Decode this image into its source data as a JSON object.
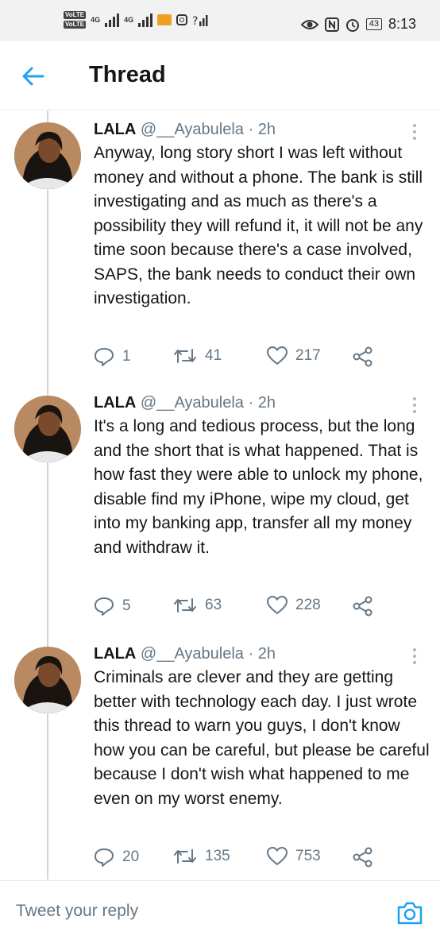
{
  "status_bar": {
    "network_badges": [
      "VoLTE",
      "VoLTE"
    ],
    "network_types": [
      "4G",
      "4G"
    ],
    "battery": "43",
    "time": "8:13",
    "icons": [
      "signal-icon",
      "instagram-icon",
      "wifi-icon",
      "eye-icon",
      "nfc-icon",
      "alarm-icon"
    ]
  },
  "header": {
    "title": "Thread"
  },
  "tweets": [
    {
      "author": "LALA",
      "handle": "@__Ayabulela",
      "time": "· 2h",
      "text": "Anyway, long story short I was left without money and without a phone. The bank is still investigating and as much as there's a possibility they will refund it, it will not be any time soon because there's a case involved, SAPS, the bank needs to conduct their own investigation.",
      "replies": "1",
      "retweets": "41",
      "likes": "217"
    },
    {
      "author": "LALA",
      "handle": "@__Ayabulela",
      "time": "· 2h",
      "text": "It's a long and tedious process, but the long and the short that is what happened. That is how fast they were able to unlock my phone, disable find my iPhone, wipe my cloud, get into my banking app, transfer all my money and withdraw it.",
      "replies": "5",
      "retweets": "63",
      "likes": "228"
    },
    {
      "author": "LALA",
      "handle": "@__Ayabulela",
      "time": "· 2h",
      "text": "Criminals are clever and they are getting better with technology each day. I just wrote this thread to warn you guys, I don't know how you can be careful, but please be careful because I don't wish what happened to me even on my worst enemy.",
      "replies": "20",
      "retweets": "135",
      "likes": "753"
    }
  ],
  "reply_bar": {
    "placeholder": "Tweet your reply"
  },
  "colors": {
    "accent": "#1da1f2",
    "text": "#14171a",
    "secondary": "#657786",
    "divider": "#e6ecf0"
  }
}
